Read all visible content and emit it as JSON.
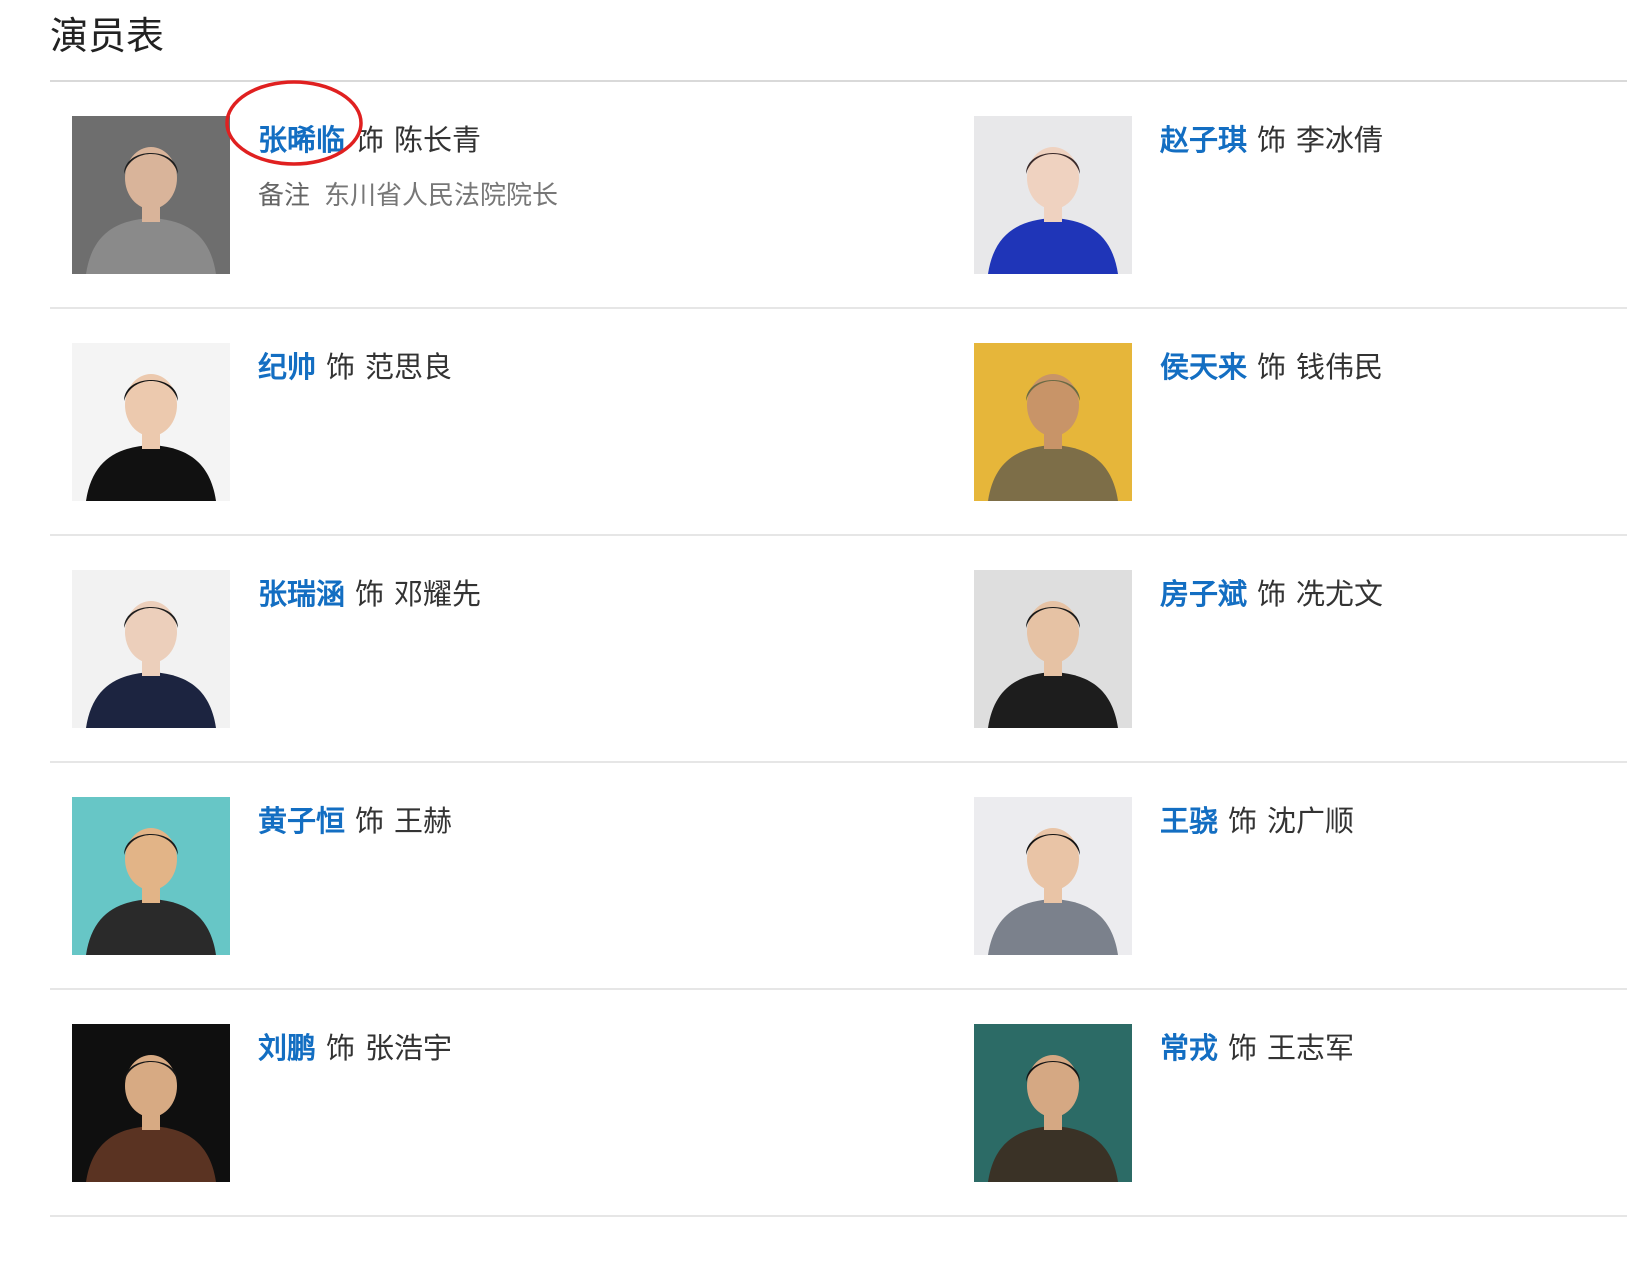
{
  "header": {
    "title": "演员表"
  },
  "labels": {
    "role_word": "饰",
    "note_label": "备注"
  },
  "colors": {
    "link": "#136ec2",
    "annotation": "#e02020"
  },
  "cast": [
    {
      "actor": "张晞临",
      "role": "陈长青",
      "note": "东川省人民法院院长",
      "photo": {
        "bg": "#6e6e6e",
        "skin": "#d9b49a",
        "hair": "#1f1f1f",
        "clothes": "#8a8a8a"
      }
    },
    {
      "actor": "赵子琪",
      "role": "李冰倩",
      "note": "",
      "photo": {
        "bg": "#e8e8ea",
        "skin": "#efd2c0",
        "hair": "#3a2a2a",
        "clothes": "#1f35b8"
      }
    },
    {
      "actor": "纪帅",
      "role": "范思良",
      "note": "",
      "photo": {
        "bg": "#f4f4f4",
        "skin": "#ecc9ae",
        "hair": "#141414",
        "clothes": "#111111"
      }
    },
    {
      "actor": "侯天来",
      "role": "钱伟民",
      "note": "",
      "photo": {
        "bg": "#e6b63a",
        "skin": "#c89468",
        "hair": "#6b6a45",
        "clothes": "#7d6e48"
      }
    },
    {
      "actor": "张瑞涵",
      "role": "邓耀先",
      "note": "",
      "photo": {
        "bg": "#f2f2f2",
        "skin": "#eccfbb",
        "hair": "#1e1e1e",
        "clothes": "#1c2440"
      }
    },
    {
      "actor": "房子斌",
      "role": "冼尤文",
      "note": "",
      "photo": {
        "bg": "#dedede",
        "skin": "#e6c2a4",
        "hair": "#1a1a1a",
        "clothes": "#1d1d1d"
      }
    },
    {
      "actor": "黄子恒",
      "role": "王赫",
      "note": "",
      "photo": {
        "bg": "#67c6c6",
        "skin": "#e2b487",
        "hair": "#1b1b1b",
        "clothes": "#2a2a2a"
      }
    },
    {
      "actor": "王骁",
      "role": "沈广顺",
      "note": "",
      "photo": {
        "bg": "#ececef",
        "skin": "#e9c4a6",
        "hair": "#141414",
        "clothes": "#7b818c"
      }
    },
    {
      "actor": "刘鹏",
      "role": "张浩宇",
      "note": "",
      "photo": {
        "bg": "#0f0f0f",
        "skin": "#d7aa83",
        "hair": "#161616",
        "clothes": "#5a3322"
      }
    },
    {
      "actor": "常戎",
      "role": "王志军",
      "note": "",
      "photo": {
        "bg": "#2c6b66",
        "skin": "#d5a883",
        "hair": "#151515",
        "clothes": "#3a3226"
      }
    }
  ]
}
